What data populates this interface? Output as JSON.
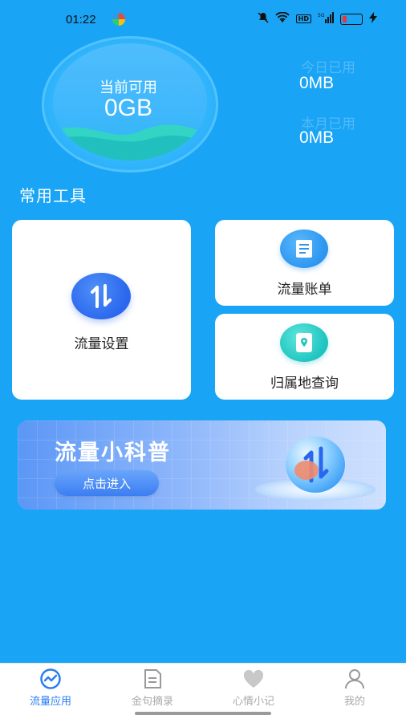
{
  "status_bar": {
    "time": "01:22",
    "hd_badge": "HD",
    "network": "5G"
  },
  "data_circle": {
    "label": "当前可用",
    "value": "0GB"
  },
  "stats": [
    {
      "label": "今日已用",
      "value": "0MB"
    },
    {
      "label": "本月已用",
      "value": "0MB"
    }
  ],
  "section_title": "常用工具",
  "tools": {
    "traffic_settings": {
      "label": "流量设置",
      "icon": "arrows-icon"
    },
    "traffic_bill": {
      "label": "流量账单",
      "icon": "document-icon"
    },
    "location_query": {
      "label": "归属地查询",
      "icon": "location-icon"
    }
  },
  "banner": {
    "title": "流量小科普",
    "button_label": "点击进入"
  },
  "tabbar": [
    {
      "label": "流量应用",
      "icon": "chart-icon",
      "active": true
    },
    {
      "label": "金句摘录",
      "icon": "note-icon",
      "active": false
    },
    {
      "label": "心情小记",
      "icon": "heart-icon",
      "active": false
    },
    {
      "label": "我的",
      "icon": "user-icon",
      "active": false
    }
  ],
  "colors": {
    "background": "#1aa4f5",
    "active_tab": "#2a7ef0",
    "inactive_tab": "#aaaaaa"
  }
}
